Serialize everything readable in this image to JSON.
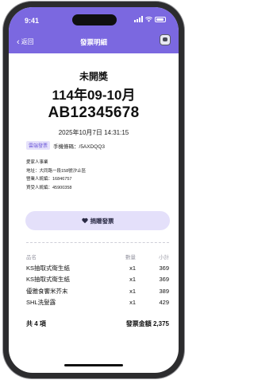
{
  "status_bar": {
    "time": "9:41"
  },
  "header": {
    "back_label": "返回",
    "title": "發票明細",
    "accent_color": "#7b68e0",
    "back_icon": "chevron-left-icon",
    "avatar_icon": "avatar"
  },
  "invoice": {
    "prize_status": "未開獎",
    "period": "114年09-10月",
    "number": "AB12345678",
    "datetime": "2025年10月7日 14:31:15",
    "type_tag": "雲端發票",
    "carrier": "手機條碼：/5AXDQQ3",
    "seller_name": "愛家人事業",
    "address": "地址：大同路一段158號汐止區",
    "seller_tax_id": "營業人統編：16846757",
    "buyer_tax_id": "買受人統編：45900358"
  },
  "donate_button": {
    "label": "捐贈發票",
    "icon": "heart-icon"
  },
  "items_table": {
    "headers": {
      "name": "品名",
      "qty": "數量",
      "subtotal": "小計"
    },
    "rows": [
      {
        "name": "KS抽取式衛生紙",
        "qty": "x1",
        "subtotal": "369"
      },
      {
        "name": "KS抽取式衛生紙",
        "qty": "x1",
        "subtotal": "369"
      },
      {
        "name": "優雅食饗米芥末",
        "qty": "x1",
        "subtotal": "389"
      },
      {
        "name": "SHL洗髮露",
        "qty": "x1",
        "subtotal": "429"
      }
    ]
  },
  "summary": {
    "count": "共 4 項",
    "total": "發票金額 2,375"
  }
}
